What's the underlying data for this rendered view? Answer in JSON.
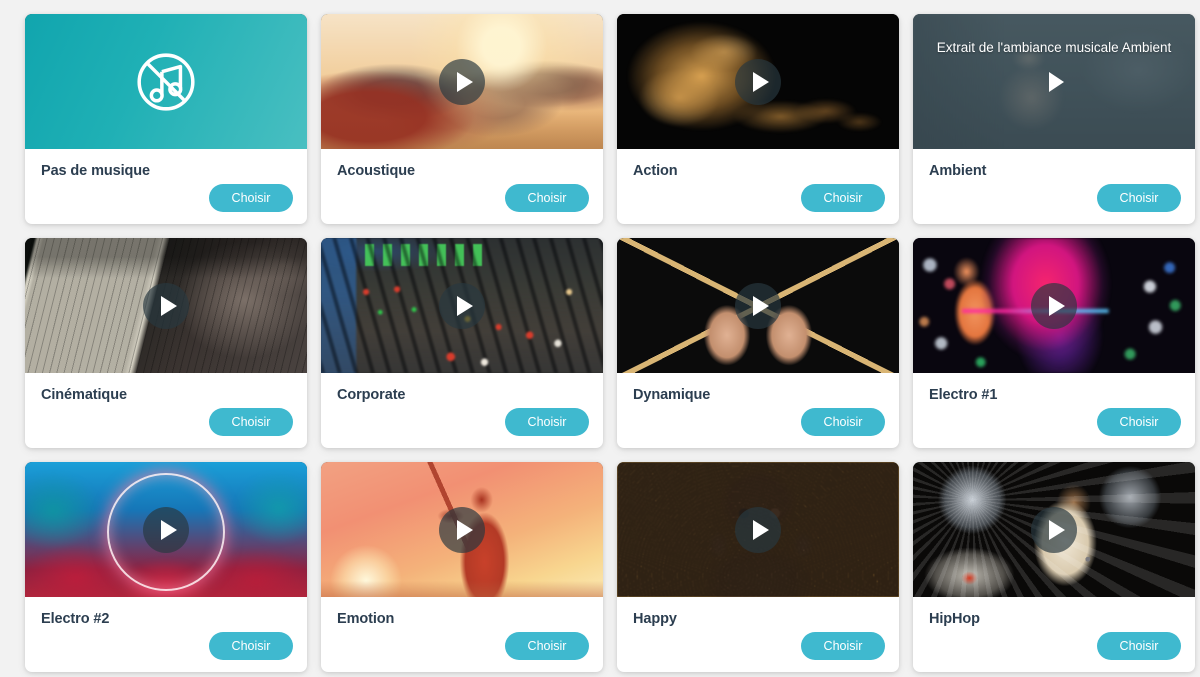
{
  "page": {
    "background_color": "#f2f2f2",
    "accent_color": "#3fb9cf",
    "title_color": "#2c3e50"
  },
  "labels": {
    "choose": "Choisir",
    "play_icon": "play-icon",
    "no_music_icon": "no-music-icon"
  },
  "cards": [
    {
      "id": "pas-de-musique",
      "title": "Pas de musique",
      "button": "Choisir",
      "art": "no-music-placeholder",
      "has_play": false,
      "overlay": null
    },
    {
      "id": "acoustique",
      "title": "Acoustique",
      "button": "Choisir",
      "art": "friends-beach-guitar-sunset",
      "has_play": true,
      "overlay": null
    },
    {
      "id": "action",
      "title": "Action",
      "button": "Choisir",
      "art": "golden-smoke-on-black",
      "has_play": true,
      "overlay": null
    },
    {
      "id": "ambient",
      "title": "Ambient",
      "button": "Choisir",
      "art": "meditation-woman-muted",
      "has_play": true,
      "overlay": "Extrait de l'ambiance musicale Ambient"
    },
    {
      "id": "cinematique",
      "title": "Cinématique",
      "button": "Choisir",
      "art": "old-sheet-music-dark",
      "has_play": true,
      "overlay": null
    },
    {
      "id": "corporate",
      "title": "Corporate",
      "button": "Choisir",
      "art": "audio-mixing-console",
      "has_play": true,
      "overlay": null
    },
    {
      "id": "dynamique",
      "title": "Dynamique",
      "button": "Choisir",
      "art": "crossed-drumsticks-black",
      "has_play": true,
      "overlay": null
    },
    {
      "id": "electro-1",
      "title": "Electro #1",
      "button": "Choisir",
      "art": "neon-face-bokeh",
      "has_play": true,
      "overlay": null
    },
    {
      "id": "electro-2",
      "title": "Electro #2",
      "button": "Choisir",
      "art": "neon-palms-ring",
      "has_play": true,
      "overlay": null
    },
    {
      "id": "emotion",
      "title": "Emotion",
      "button": "Choisir",
      "art": "violinist-sunset-silhouette",
      "has_play": true,
      "overlay": null
    },
    {
      "id": "happy",
      "title": "Happy",
      "button": "Choisir",
      "art": "woman-leopard-coat-yellow",
      "has_play": true,
      "overlay": null
    },
    {
      "id": "hiphop",
      "title": "HipHop",
      "button": "Choisir",
      "art": "dog-headphones-discoballs",
      "has_play": true,
      "overlay": null
    }
  ]
}
